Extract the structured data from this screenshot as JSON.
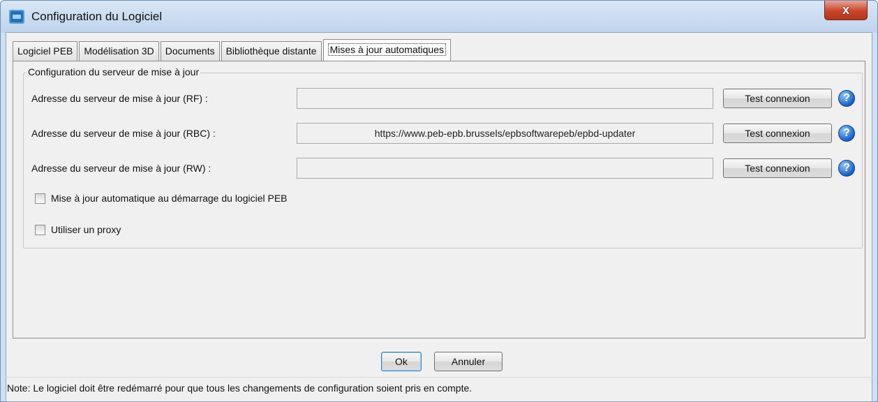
{
  "window": {
    "title": "Configuration du Logiciel",
    "close_label": "x"
  },
  "tabs": [
    {
      "label": "Logiciel PEB"
    },
    {
      "label": "Modélisation 3D"
    },
    {
      "label": "Documents"
    },
    {
      "label": "Bibliothèque distante"
    },
    {
      "label": "Mises à jour automatiques"
    }
  ],
  "group": {
    "title": "Configuration du serveur de mise à jour",
    "rows": [
      {
        "label": "Adresse du serveur de mise à jour (RF) :",
        "value": "",
        "button": "Test connexion"
      },
      {
        "label": "Adresse du serveur de mise à jour (RBC) :",
        "value": "https://www.peb-epb.brussels/epbsoftwarepeb/epbd-updater",
        "button": "Test connexion"
      },
      {
        "label": "Adresse du serveur de mise à jour (RW) :",
        "value": "",
        "button": "Test connexion"
      }
    ],
    "help_glyph": "?",
    "checkboxes": [
      {
        "label": "Mise à jour automatique au démarrage du logiciel PEB",
        "checked": false
      },
      {
        "label": "Utiliser un proxy",
        "checked": false
      }
    ]
  },
  "footer": {
    "ok_label": "Ok",
    "cancel_label": "Annuler",
    "note": "Note: Le logiciel doit être redémarré pour que tous les changements de configuration soient pris en compte."
  }
}
